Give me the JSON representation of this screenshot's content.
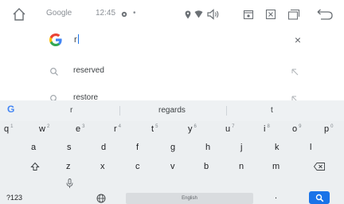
{
  "statusbar": {
    "app_name": "Google",
    "time": "12:45",
    "separator": "•"
  },
  "search": {
    "query": "r",
    "clear": "×"
  },
  "suggestions": [
    {
      "text": "reserved"
    },
    {
      "text": "restore"
    }
  ],
  "keyboard": {
    "candidates": [
      "r",
      "regards",
      "t"
    ],
    "row1": [
      {
        "k": "q",
        "h": "1"
      },
      {
        "k": "w",
        "h": "2"
      },
      {
        "k": "e",
        "h": "3"
      },
      {
        "k": "r",
        "h": "4"
      },
      {
        "k": "t",
        "h": "5"
      },
      {
        "k": "y",
        "h": "6"
      },
      {
        "k": "u",
        "h": "7"
      },
      {
        "k": "i",
        "h": "8"
      },
      {
        "k": "o",
        "h": "9"
      },
      {
        "k": "p",
        "h": "0"
      }
    ],
    "row2": [
      "a",
      "s",
      "d",
      "f",
      "g",
      "h",
      "j",
      "k",
      "l"
    ],
    "row3": [
      "z",
      "x",
      "c",
      "v",
      "b",
      "n",
      "m"
    ],
    "symbols_key": "?123",
    "space_label": "English",
    "period_key": "."
  },
  "colors": {
    "accent": "#1a73e8",
    "keyboard_bg": "#eceff1"
  },
  "icons": [
    "home-icon",
    "gear-icon",
    "location-icon",
    "wifi-icon",
    "volume-icon",
    "screenshot-icon",
    "close-box-icon",
    "recents-icon",
    "back-icon",
    "google-g-icon",
    "search-icon",
    "arrow-up-left-icon",
    "shift-icon",
    "backspace-icon",
    "mic-icon",
    "globe-icon"
  ]
}
